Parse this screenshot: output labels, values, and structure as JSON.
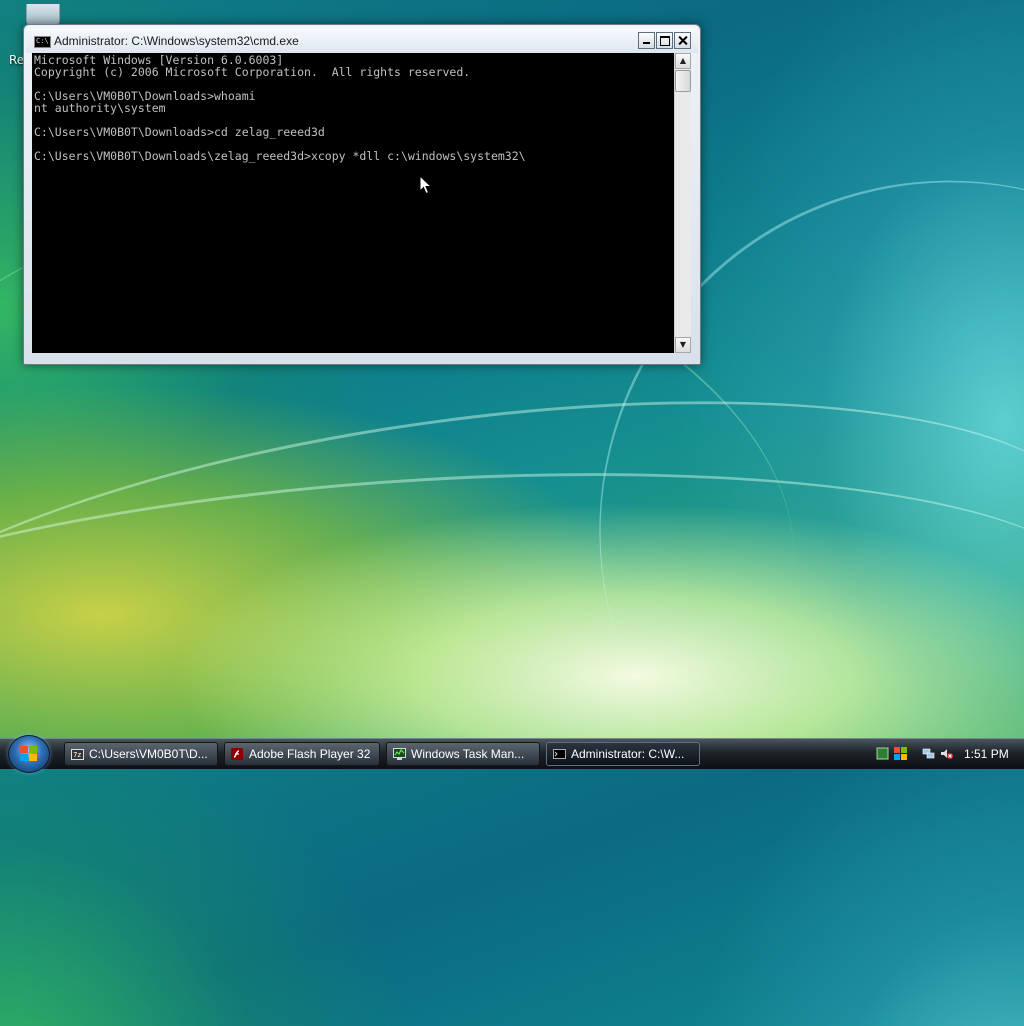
{
  "desktop": {
    "recycle_label": "Re"
  },
  "cmd": {
    "title": "Administrator: C:\\Windows\\system32\\cmd.exe",
    "icon_text": "C:\\",
    "lines": [
      "Microsoft Windows [Version 6.0.6003]",
      "Copyright (c) 2006 Microsoft Corporation.  All rights reserved.",
      "",
      "C:\\Users\\VM0B0T\\Downloads>whoami",
      "nt authority\\system",
      "",
      "C:\\Users\\VM0B0T\\Downloads>cd zelag_reeed3d",
      "",
      "C:\\Users\\VM0B0T\\Downloads\\zelag_reeed3d>xcopy *dll c:\\windows\\system32\\"
    ],
    "scroll_up": "▲",
    "scroll_down": "▼"
  },
  "taskbar": {
    "buttons": [
      {
        "label": "C:\\Users\\VM0B0T\\D...",
        "icon": "folder-icon"
      },
      {
        "label": "Adobe Flash Player 32",
        "icon": "flash-icon"
      },
      {
        "label": "Windows Task Man...",
        "icon": "task-manager-icon"
      },
      {
        "label": "Administrator: C:\\W...",
        "icon": "cmd-icon"
      }
    ],
    "clock": "1:51 PM"
  },
  "colors": {
    "console_bg": "#000000",
    "console_fg": "#c0c0c0",
    "flag_red": "#f25022",
    "flag_green": "#7fba00",
    "flag_blue": "#00a4ef",
    "flag_yellow": "#ffb900"
  }
}
